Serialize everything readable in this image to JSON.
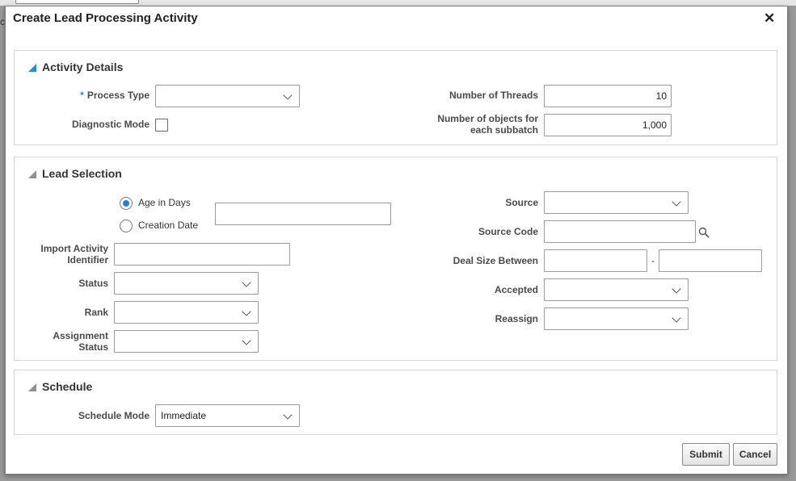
{
  "dialog": {
    "title": "Create Lead Processing Activity"
  },
  "background": {
    "visible_char": "c"
  },
  "activity_details": {
    "title": "Activity Details",
    "process_type": {
      "required_marker": "*",
      "label": "Process Type",
      "value": ""
    },
    "diagnostic_mode": {
      "label": "Diagnostic Mode",
      "checked": false
    },
    "number_of_threads": {
      "label": "Number of Threads",
      "value": "10"
    },
    "objects_per_subbatch": {
      "label_line1": "Number of objects for",
      "label_line2": "each subbatch",
      "value": "1,000"
    }
  },
  "lead_selection": {
    "title": "Lead Selection",
    "age_option": {
      "label": "Age in Days",
      "selected": true
    },
    "creation_date_option": {
      "label": "Creation Date",
      "selected": false
    },
    "age_value": "",
    "import_activity": {
      "label_line1": "Import Activity",
      "label_line2": "Identifier",
      "value": ""
    },
    "status": {
      "label": "Status",
      "value": ""
    },
    "rank": {
      "label": "Rank",
      "value": ""
    },
    "assignment_status": {
      "label_line1": "Assignment",
      "label_line2": "Status",
      "value": ""
    },
    "source": {
      "label": "Source",
      "value": ""
    },
    "source_code": {
      "label": "Source Code",
      "value": ""
    },
    "deal_size": {
      "label": "Deal Size Between",
      "separator": "-",
      "from": "",
      "to": ""
    },
    "accepted": {
      "label": "Accepted",
      "value": ""
    },
    "reassign": {
      "label": "Reassign",
      "value": ""
    }
  },
  "schedule": {
    "title": "Schedule",
    "schedule_mode": {
      "label": "Schedule Mode",
      "value": "Immediate"
    }
  },
  "footer": {
    "submit_label": "Submit",
    "cancel_label": "Cancel"
  },
  "colors": {
    "accent": "#2e8bd6",
    "collapse_triangle": "#8f8f8f"
  }
}
